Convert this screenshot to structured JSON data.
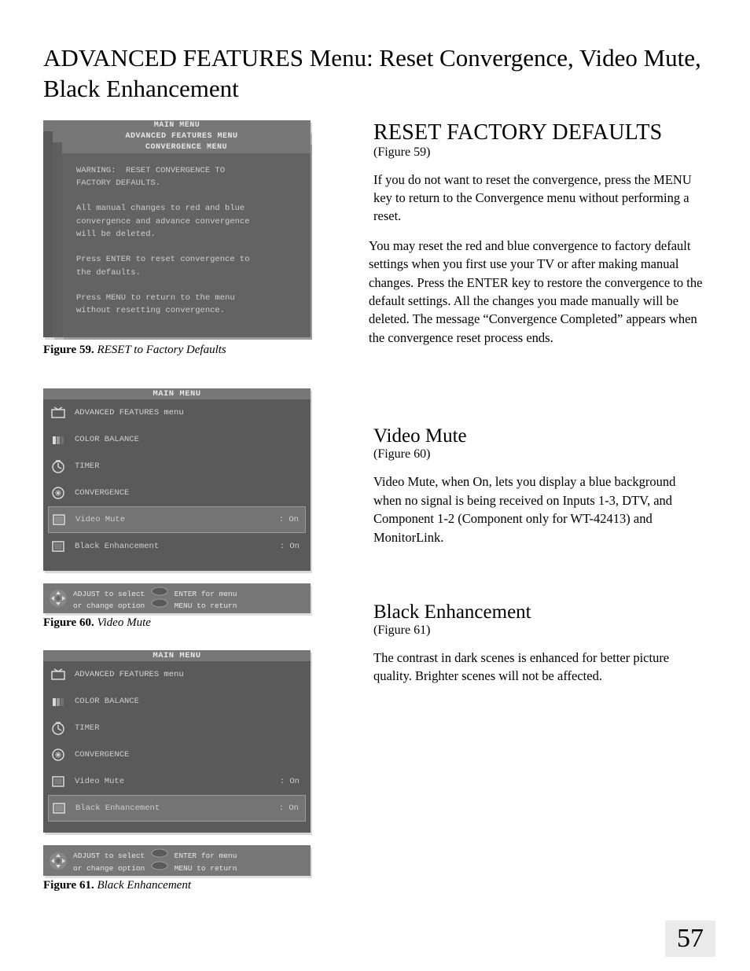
{
  "page_title": "ADVANCED FEATURES Menu: Reset Convergence, Video Mute, Black Enhancement",
  "page_number": "57",
  "fig59": {
    "caption_label": "Figure 59.",
    "caption_text": "RESET to Factory Defaults",
    "header_1": "MAIN MENU",
    "header_2": "ADVANCED FEATURES MENU",
    "header_3": "CONVERGENCE MENU",
    "body": "WARNING:  RESET CONVERGENCE TO\nFACTORY DEFAULTS.\n\nAll manual changes to red and blue\nconvergence and advance convergence\nwill be deleted.\n\nPress ENTER to reset convergence to\nthe defaults.\n\nPress MENU to return to the menu\nwithout resetting convergence."
  },
  "fig60": {
    "caption_label": "Figure 60.",
    "caption_text": "Video Mute",
    "header": "MAIN MENU",
    "subheader": "ADVANCED FEATURES menu",
    "rows": [
      {
        "label": "COLOR BALANCE",
        "val": ""
      },
      {
        "label": "TIMER",
        "val": ""
      },
      {
        "label": "CONVERGENCE",
        "val": ""
      },
      {
        "label": "Video Mute",
        "val": ": On",
        "hl": true
      },
      {
        "label": "Black Enhancement",
        "val": ": On"
      }
    ],
    "hint_adjust": "ADJUST to select",
    "hint_change": "or change option",
    "hint_enter": "ENTER for menu",
    "hint_menu": "MENU to return"
  },
  "fig61": {
    "caption_label": "Figure 61.",
    "caption_text": "Black Enhancement",
    "header": "MAIN MENU",
    "subheader": "ADVANCED FEATURES menu",
    "rows": [
      {
        "label": "COLOR BALANCE",
        "val": ""
      },
      {
        "label": "TIMER",
        "val": ""
      },
      {
        "label": "CONVERGENCE",
        "val": ""
      },
      {
        "label": "Video Mute",
        "val": ": On"
      },
      {
        "label": "Black Enhancement",
        "val": ": On",
        "hl": true
      }
    ],
    "hint_adjust": "ADJUST to select",
    "hint_change": "or change option",
    "hint_enter": "ENTER for menu",
    "hint_menu": "MENU to return"
  },
  "right": {
    "sec1_h": "RESET FACTORY DEFAULTS",
    "sec1_sub": "(Figure 59)",
    "sec1_p1": "If you do not want to reset the convergence, press the MENU key to return to the Convergence menu without performing a reset.",
    "sec1_p2": "You may reset the red and blue convergence to factory default settings when you first use your TV or after making manual changes. Press the ENTER key to restore the convergence to the default settings. All the changes you made manually will be deleted. The message  “Convergence Completed” appears when the convergence reset process ends.",
    "sec2_h": "Video Mute",
    "sec2_sub": "(Figure 60)",
    "sec2_p1": "Video Mute, when On, lets you display a blue background when no signal is being received on Inputs 1-3, DTV, and Component 1-2 (Component only for WT-42413)  and MonitorLink.",
    "sec3_h": "Black Enhancement",
    "sec3_sub": "(Figure 61)",
    "sec3_p1": "The contrast in dark scenes is enhanced for better picture quality.  Brighter scenes will not be affected."
  }
}
